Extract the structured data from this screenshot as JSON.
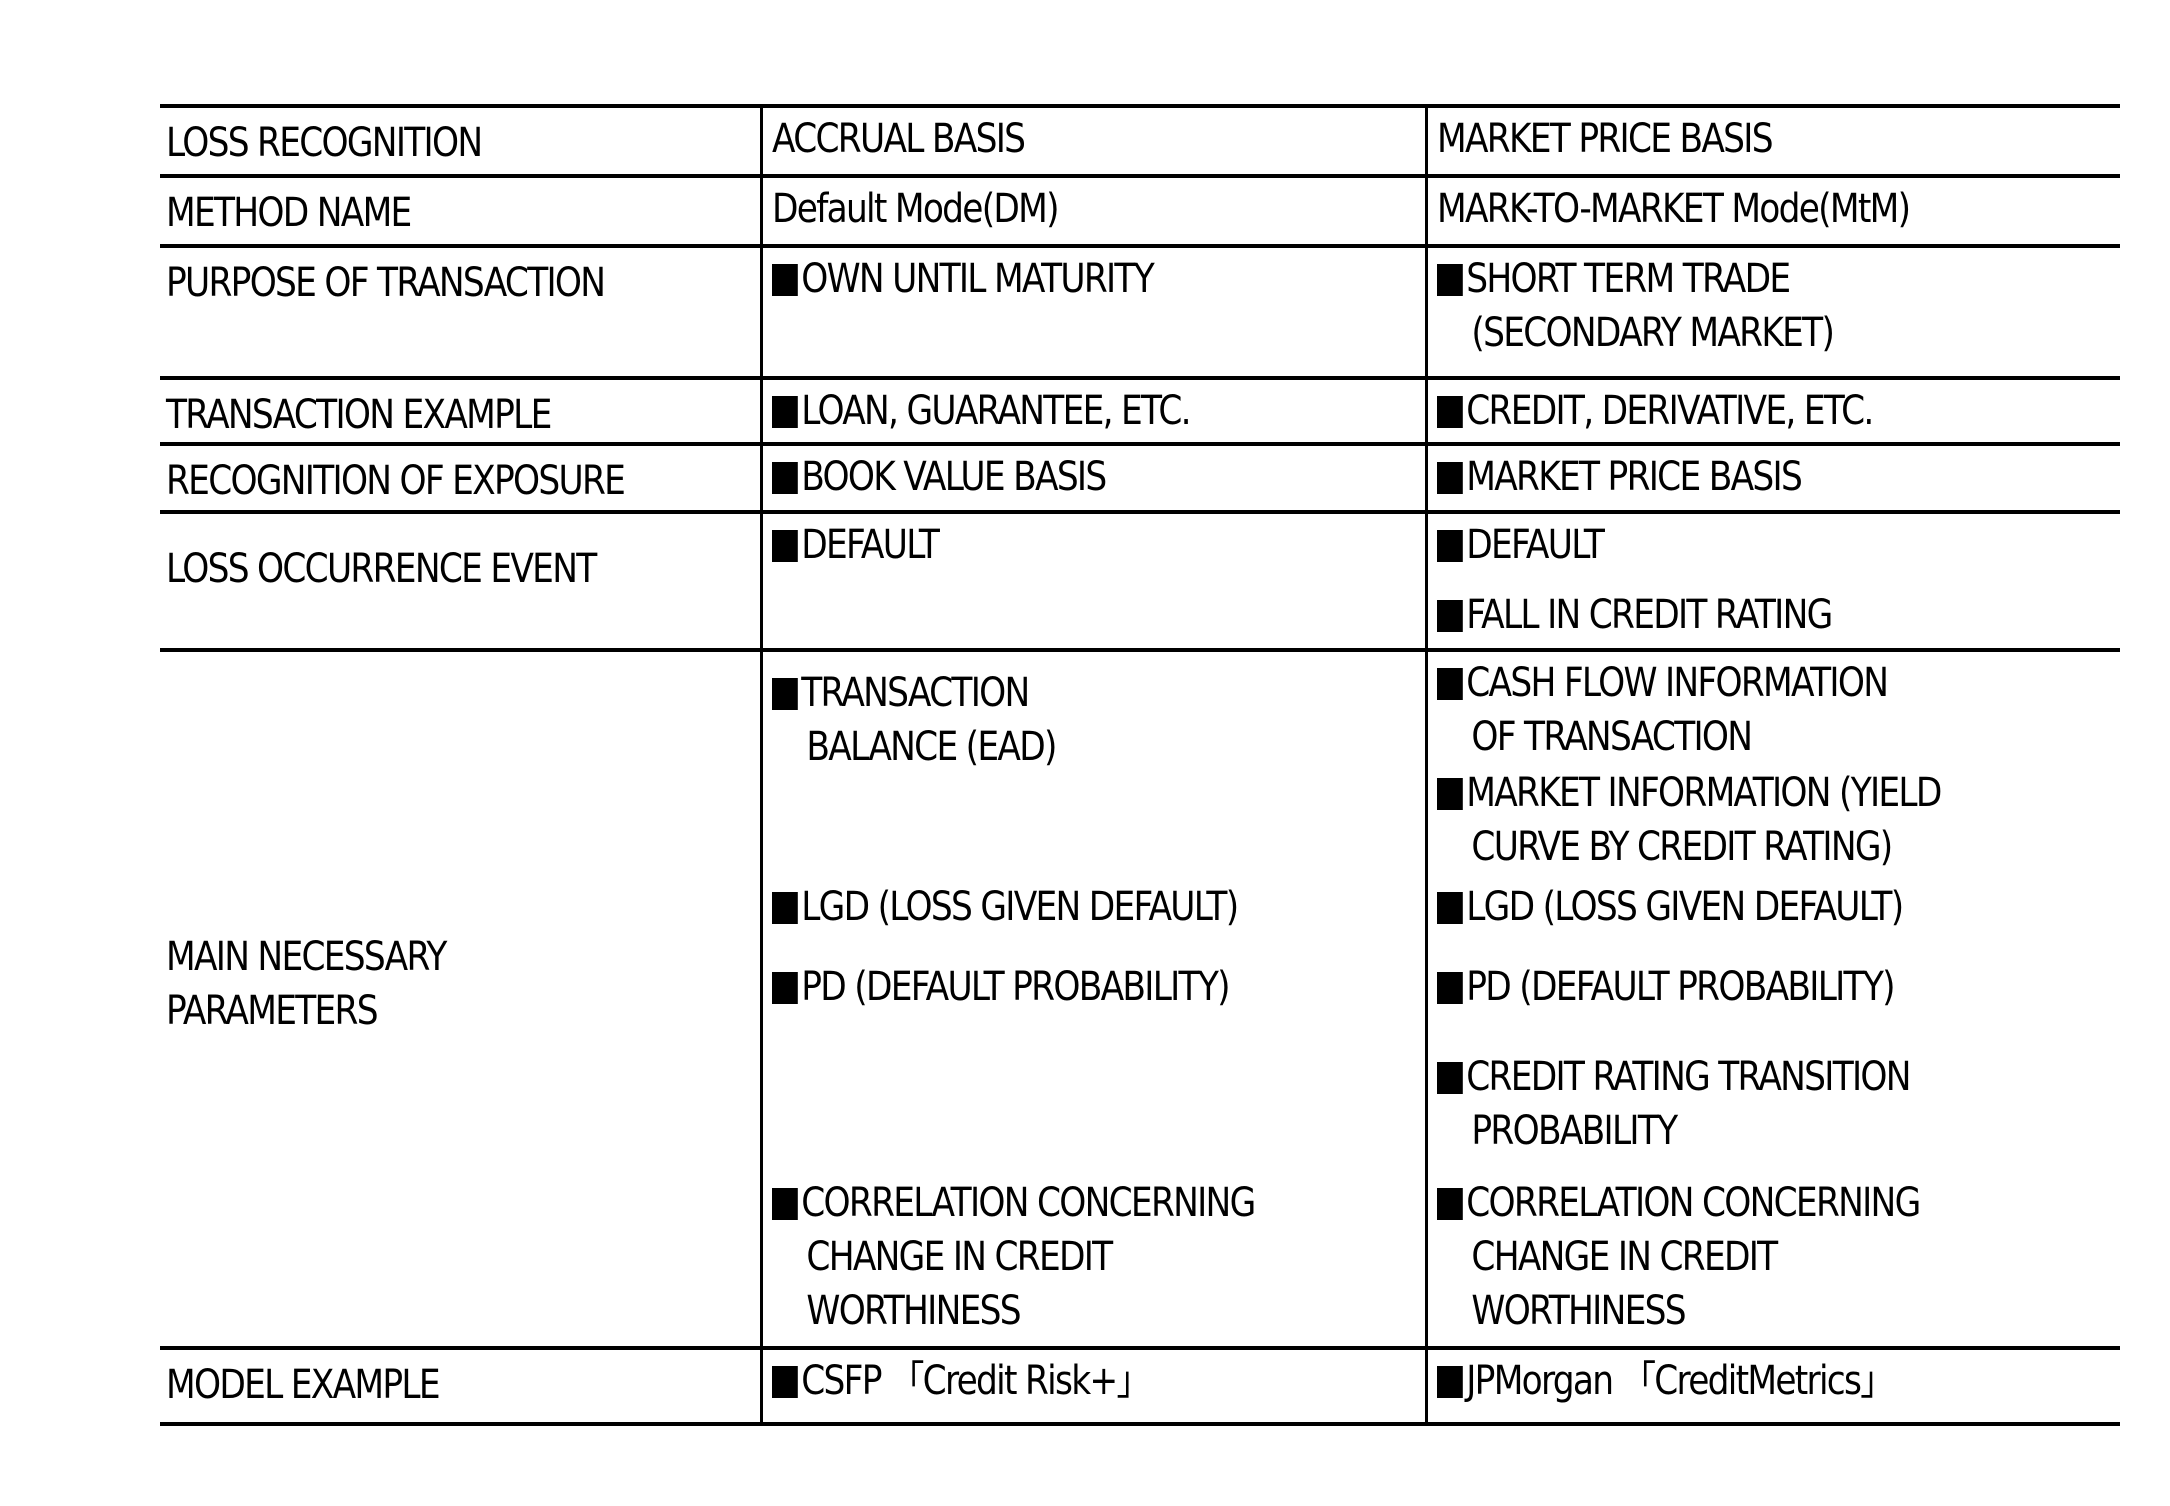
{
  "table": {
    "rows": [
      {
        "label": [
          "LOSS RECOGNITION"
        ],
        "accrual": [
          {
            "bullet": false,
            "lines": [
              "ACCRUAL BASIS"
            ]
          }
        ],
        "market": [
          {
            "bullet": false,
            "lines": [
              "MARKET PRICE BASIS"
            ]
          }
        ]
      },
      {
        "label": [
          "METHOD NAME"
        ],
        "accrual": [
          {
            "bullet": false,
            "lines": [
              "Default Mode(DM)"
            ]
          }
        ],
        "market": [
          {
            "bullet": false,
            "lines": [
              "MARK-TO-MARKET Mode(MtM)"
            ]
          }
        ]
      },
      {
        "label": [
          "PURPOSE OF TRANSACTION"
        ],
        "accrual": [
          {
            "bullet": true,
            "lines": [
              "OWN UNTIL MATURITY"
            ]
          }
        ],
        "market": [
          {
            "bullet": true,
            "lines": [
              "SHORT TERM TRADE",
              "(SECONDARY MARKET)"
            ]
          }
        ]
      },
      {
        "label": [
          "TRANSACTION EXAMPLE"
        ],
        "accrual": [
          {
            "bullet": true,
            "lines": [
              "LOAN, GUARANTEE, ETC."
            ]
          }
        ],
        "market": [
          {
            "bullet": true,
            "lines": [
              "CREDIT, DERIVATIVE, ETC."
            ]
          }
        ]
      },
      {
        "label": [
          "RECOGNITION OF EXPOSURE"
        ],
        "accrual": [
          {
            "bullet": true,
            "lines": [
              "BOOK VALUE BASIS"
            ]
          }
        ],
        "market": [
          {
            "bullet": true,
            "lines": [
              "MARKET PRICE BASIS"
            ]
          }
        ]
      },
      {
        "label": [
          "LOSS OCCURRENCE EVENT"
        ],
        "accrual": [
          {
            "bullet": true,
            "lines": [
              "DEFAULT"
            ]
          }
        ],
        "market": [
          {
            "bullet": true,
            "lines": [
              "DEFAULT"
            ]
          },
          {
            "bullet": true,
            "lines": [
              "FALL IN CREDIT RATING"
            ]
          }
        ]
      },
      {
        "label": [
          "MAIN NECESSARY",
          "PARAMETERS"
        ],
        "accrual": [
          {
            "bullet": true,
            "lines": [
              "TRANSACTION",
              "BALANCE (EAD)"
            ]
          },
          {
            "bullet": true,
            "lines": [
              "LGD (LOSS GIVEN DEFAULT)"
            ]
          },
          {
            "bullet": true,
            "lines": [
              "PD (DEFAULT PROBABILITY)"
            ]
          },
          {
            "bullet": true,
            "lines": [
              "CORRELATION CONCERNING",
              "CHANGE IN CREDIT",
              "WORTHINESS"
            ]
          }
        ],
        "market": [
          {
            "bullet": true,
            "lines": [
              "CASH FLOW INFORMATION",
              "OF TRANSACTION"
            ]
          },
          {
            "bullet": true,
            "lines": [
              "MARKET INFORMATION (YIELD",
              "CURVE BY CREDIT RATING)"
            ]
          },
          {
            "bullet": true,
            "lines": [
              "LGD (LOSS GIVEN DEFAULT)"
            ]
          },
          {
            "bullet": true,
            "lines": [
              "PD (DEFAULT PROBABILITY)"
            ]
          },
          {
            "bullet": true,
            "lines": [
              "CREDIT RATING TRANSITION",
              "PROBABILITY"
            ]
          },
          {
            "bullet": true,
            "lines": [
              "CORRELATION CONCERNING",
              "CHANGE IN CREDIT",
              "WORTHINESS"
            ]
          }
        ]
      },
      {
        "label": [
          "MODEL EXAMPLE"
        ],
        "accrual": [
          {
            "bullet": true,
            "lines": [
              "CSFP 「Credit Risk+」"
            ]
          }
        ],
        "market": [
          {
            "bullet": true,
            "lines": [
              "JPMorgan 「CreditMetrics」"
            ]
          }
        ]
      }
    ]
  }
}
